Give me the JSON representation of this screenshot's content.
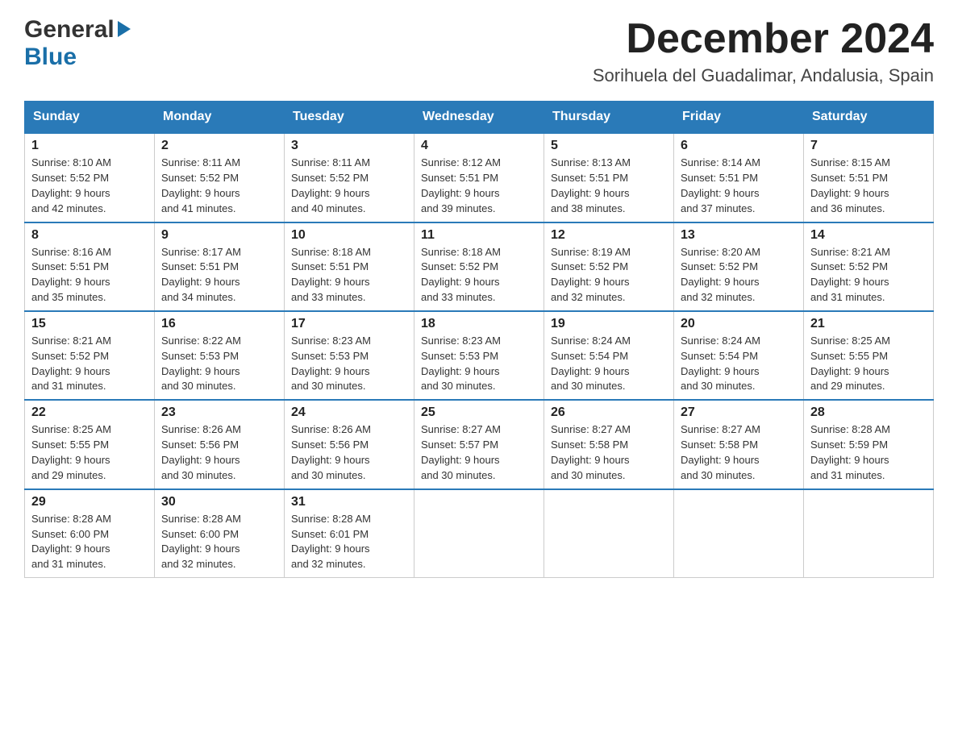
{
  "header": {
    "logo_general": "General",
    "logo_blue": "Blue",
    "month_title": "December 2024",
    "location": "Sorihuela del Guadalimar, Andalusia, Spain"
  },
  "days_of_week": [
    "Sunday",
    "Monday",
    "Tuesday",
    "Wednesday",
    "Thursday",
    "Friday",
    "Saturday"
  ],
  "weeks": [
    [
      {
        "day": "1",
        "sunrise": "8:10 AM",
        "sunset": "5:52 PM",
        "daylight": "9 hours and 42 minutes."
      },
      {
        "day": "2",
        "sunrise": "8:11 AM",
        "sunset": "5:52 PM",
        "daylight": "9 hours and 41 minutes."
      },
      {
        "day": "3",
        "sunrise": "8:11 AM",
        "sunset": "5:52 PM",
        "daylight": "9 hours and 40 minutes."
      },
      {
        "day": "4",
        "sunrise": "8:12 AM",
        "sunset": "5:51 PM",
        "daylight": "9 hours and 39 minutes."
      },
      {
        "day": "5",
        "sunrise": "8:13 AM",
        "sunset": "5:51 PM",
        "daylight": "9 hours and 38 minutes."
      },
      {
        "day": "6",
        "sunrise": "8:14 AM",
        "sunset": "5:51 PM",
        "daylight": "9 hours and 37 minutes."
      },
      {
        "day": "7",
        "sunrise": "8:15 AM",
        "sunset": "5:51 PM",
        "daylight": "9 hours and 36 minutes."
      }
    ],
    [
      {
        "day": "8",
        "sunrise": "8:16 AM",
        "sunset": "5:51 PM",
        "daylight": "9 hours and 35 minutes."
      },
      {
        "day": "9",
        "sunrise": "8:17 AM",
        "sunset": "5:51 PM",
        "daylight": "9 hours and 34 minutes."
      },
      {
        "day": "10",
        "sunrise": "8:18 AM",
        "sunset": "5:51 PM",
        "daylight": "9 hours and 33 minutes."
      },
      {
        "day": "11",
        "sunrise": "8:18 AM",
        "sunset": "5:52 PM",
        "daylight": "9 hours and 33 minutes."
      },
      {
        "day": "12",
        "sunrise": "8:19 AM",
        "sunset": "5:52 PM",
        "daylight": "9 hours and 32 minutes."
      },
      {
        "day": "13",
        "sunrise": "8:20 AM",
        "sunset": "5:52 PM",
        "daylight": "9 hours and 32 minutes."
      },
      {
        "day": "14",
        "sunrise": "8:21 AM",
        "sunset": "5:52 PM",
        "daylight": "9 hours and 31 minutes."
      }
    ],
    [
      {
        "day": "15",
        "sunrise": "8:21 AM",
        "sunset": "5:52 PM",
        "daylight": "9 hours and 31 minutes."
      },
      {
        "day": "16",
        "sunrise": "8:22 AM",
        "sunset": "5:53 PM",
        "daylight": "9 hours and 30 minutes."
      },
      {
        "day": "17",
        "sunrise": "8:23 AM",
        "sunset": "5:53 PM",
        "daylight": "9 hours and 30 minutes."
      },
      {
        "day": "18",
        "sunrise": "8:23 AM",
        "sunset": "5:53 PM",
        "daylight": "9 hours and 30 minutes."
      },
      {
        "day": "19",
        "sunrise": "8:24 AM",
        "sunset": "5:54 PM",
        "daylight": "9 hours and 30 minutes."
      },
      {
        "day": "20",
        "sunrise": "8:24 AM",
        "sunset": "5:54 PM",
        "daylight": "9 hours and 30 minutes."
      },
      {
        "day": "21",
        "sunrise": "8:25 AM",
        "sunset": "5:55 PM",
        "daylight": "9 hours and 29 minutes."
      }
    ],
    [
      {
        "day": "22",
        "sunrise": "8:25 AM",
        "sunset": "5:55 PM",
        "daylight": "9 hours and 29 minutes."
      },
      {
        "day": "23",
        "sunrise": "8:26 AM",
        "sunset": "5:56 PM",
        "daylight": "9 hours and 30 minutes."
      },
      {
        "day": "24",
        "sunrise": "8:26 AM",
        "sunset": "5:56 PM",
        "daylight": "9 hours and 30 minutes."
      },
      {
        "day": "25",
        "sunrise": "8:27 AM",
        "sunset": "5:57 PM",
        "daylight": "9 hours and 30 minutes."
      },
      {
        "day": "26",
        "sunrise": "8:27 AM",
        "sunset": "5:58 PM",
        "daylight": "9 hours and 30 minutes."
      },
      {
        "day": "27",
        "sunrise": "8:27 AM",
        "sunset": "5:58 PM",
        "daylight": "9 hours and 30 minutes."
      },
      {
        "day": "28",
        "sunrise": "8:28 AM",
        "sunset": "5:59 PM",
        "daylight": "9 hours and 31 minutes."
      }
    ],
    [
      {
        "day": "29",
        "sunrise": "8:28 AM",
        "sunset": "6:00 PM",
        "daylight": "9 hours and 31 minutes."
      },
      {
        "day": "30",
        "sunrise": "8:28 AM",
        "sunset": "6:00 PM",
        "daylight": "9 hours and 32 minutes."
      },
      {
        "day": "31",
        "sunrise": "8:28 AM",
        "sunset": "6:01 PM",
        "daylight": "9 hours and 32 minutes."
      },
      null,
      null,
      null,
      null
    ]
  ],
  "labels": {
    "sunrise": "Sunrise:",
    "sunset": "Sunset:",
    "daylight": "Daylight:"
  }
}
